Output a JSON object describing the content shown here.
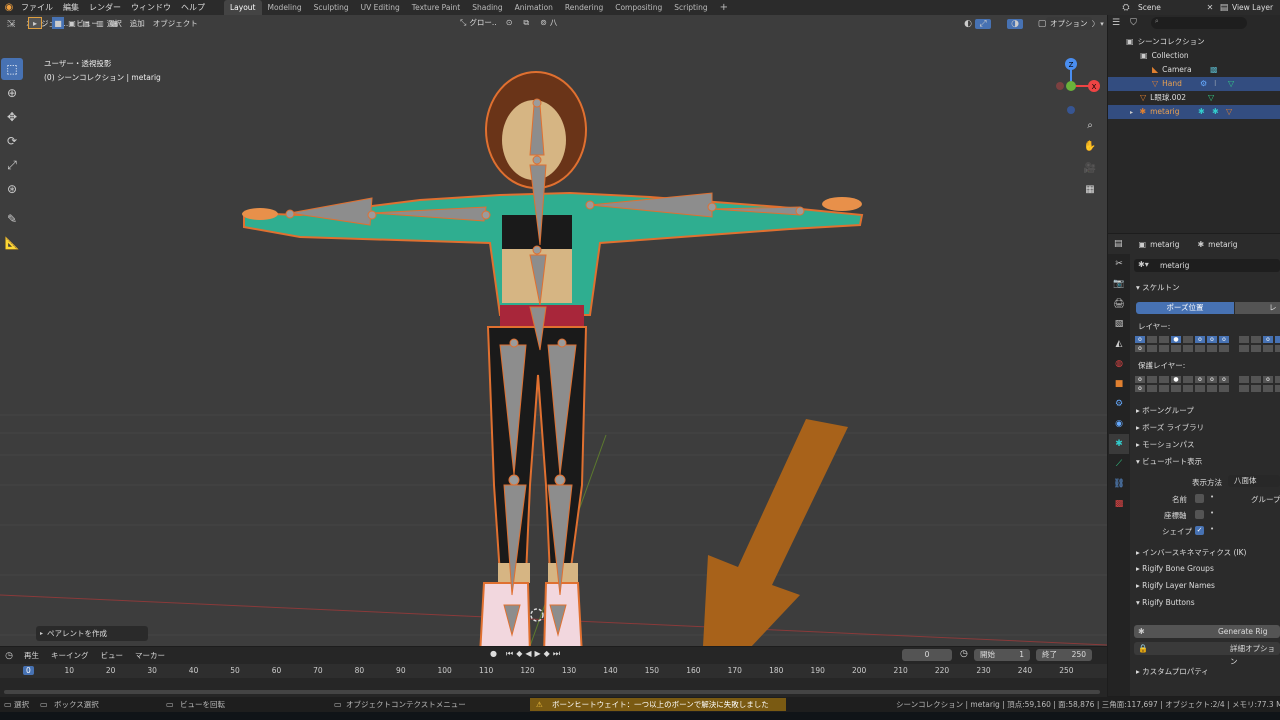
{
  "menubar": {
    "items": [
      "ファイル",
      "編集",
      "レンダー",
      "ウィンドウ",
      "ヘルプ"
    ],
    "workspaces": [
      "Layout",
      "Modeling",
      "Sculpting",
      "UV Editing",
      "Texture Paint",
      "Shading",
      "Animation",
      "Rendering",
      "Compositing",
      "Scripting"
    ],
    "add_tab": "+",
    "scene": "Scene",
    "view_layer": "View Layer"
  },
  "viewport_header": {
    "mode": "オブジェク..",
    "menus": [
      "ビュー",
      "選択",
      "追加",
      "オブジェクト"
    ],
    "orientation": "グロー..",
    "pivot_label": "八",
    "options": "オプション"
  },
  "overlay_text": {
    "line1": "ユーザー・透視投影",
    "line2": "(0) シーンコレクション | metarig"
  },
  "gizmo": {
    "x": "X",
    "y": "Y",
    "z": "Z"
  },
  "outliner": {
    "title": "シーンコレクション",
    "items": [
      {
        "label": "Collection"
      },
      {
        "label": "Camera"
      },
      {
        "label": "Hand"
      },
      {
        "label": "L眼球.002"
      },
      {
        "label": "metarig"
      }
    ]
  },
  "properties": {
    "context_object": "metarig",
    "context_data": "metarig",
    "data_name": "metarig",
    "skeleton_header": "スケルトン",
    "pose_position": "ポーズ位置",
    "rest_position": "レス",
    "layers_label": "レイヤー:",
    "protected_layers_label": "保護レイヤー:",
    "sections": [
      "ボーングループ",
      "ボーズ ライブラリ",
      "モーションパス"
    ],
    "viewport_display": "ビューポート表示",
    "display_as_label": "表示方法",
    "display_as_value": "八面体",
    "names_label": "名前",
    "axes_label": "座標軸",
    "shape_label": "シェイプ",
    "group_label": "グループ",
    "ik_section": "インバースキネマティクス (IK)",
    "rigify_bone_groups": "Rigify Bone Groups",
    "rigify_layer_names": "Rigify Layer Names",
    "rigify_buttons": "Rigify Buttons",
    "generate_rig": "Generate Rig",
    "advanced_options": "詳細オプション",
    "custom_props": "カスタムプロパティ"
  },
  "timeline": {
    "menus": [
      "再生",
      "キーイング",
      "ビュー",
      "マーカー"
    ],
    "current_frame": "0",
    "start_label": "開始",
    "start_value": "1",
    "end_label": "終了",
    "end_value": "250",
    "ticks": [
      "0",
      "10",
      "20",
      "30",
      "40",
      "50",
      "60",
      "70",
      "80",
      "90",
      "100",
      "110",
      "120",
      "130",
      "140",
      "150",
      "160",
      "170",
      "180",
      "190",
      "200",
      "210",
      "220",
      "230",
      "240",
      "250"
    ]
  },
  "redo_panel": {
    "label": "ペアレントを作成"
  },
  "statusbar": {
    "select": "選択",
    "box_select": "ボックス選択",
    "rotate_view": "ビューを回転",
    "context_menu": "オブジェクトコンテクストメニュー",
    "warning": "ボーンヒートウェイト：一つ以上のボーンで解決に失敗しました",
    "stats": "シーンコレクション | metarig | 頂点:59,160 | 面:58,876 | 三角面:117,697 | オブジェクト:2/4 | メモリ:77.3 M"
  },
  "colors": {
    "accent": "#4772b3",
    "arrow": "#a8621a",
    "warning_bg": "#7a5a12",
    "selected_row": "#334d80"
  }
}
